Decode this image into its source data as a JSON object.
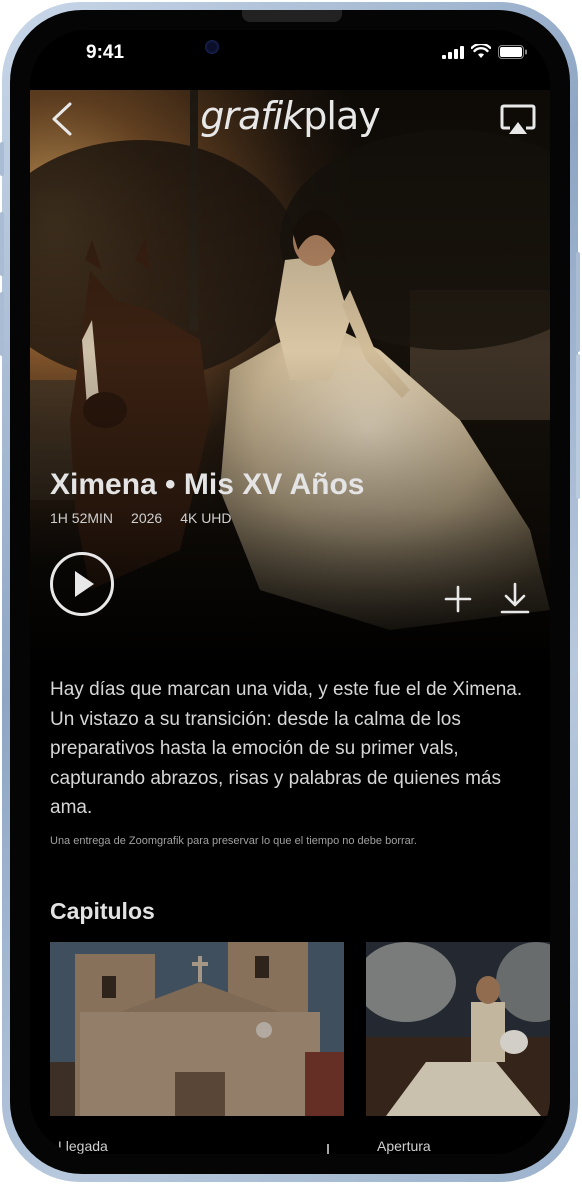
{
  "status_bar": {
    "time": "9:41"
  },
  "nav": {
    "logo_part1": "grafik",
    "logo_part2": "play"
  },
  "movie": {
    "title": "Ximena • Mis XV Años",
    "duration": "1H 52MIN",
    "year": "2026",
    "quality": "4K UHD"
  },
  "description": "Hay días que marcan una vida, y este fue el de Ximena. Un vistazo a su transición: desde la calma de los preparativos hasta la emoción de su primer vals, capturando abrazos, risas y palabras de quienes más ama.",
  "credit": "Una entrega de Zoomgrafik para preservar lo que el tiempo no debe borrar.",
  "chapters": {
    "title": "Capitulos",
    "items": [
      {
        "label": "Llegada"
      },
      {
        "label": "Apertura"
      }
    ]
  },
  "colors": {
    "background": "#000000",
    "text": "#d6d6d6",
    "frame": "#9cb2cc"
  },
  "icons": [
    "back-icon",
    "airplay-icon",
    "play-icon",
    "plus-icon",
    "download-icon",
    "signal-icon",
    "wifi-icon",
    "battery-icon"
  ]
}
